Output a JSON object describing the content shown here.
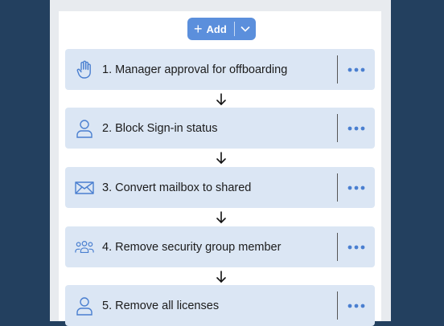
{
  "toolbar": {
    "add_label": "Add"
  },
  "steps": [
    {
      "label": "1. Manager approval for offboarding",
      "icon": "hand-icon"
    },
    {
      "label": "2. Block Sign-in status",
      "icon": "user-icon"
    },
    {
      "label": "3. Convert mailbox to shared",
      "icon": "mail-icon"
    },
    {
      "label": "4. Remove security group member",
      "icon": "group-icon"
    },
    {
      "label": "5. Remove all licenses",
      "icon": "user-icon"
    }
  ],
  "colors": {
    "accent": "#5b8fdc",
    "card": "#dbe6f4",
    "background": "#23405f"
  }
}
